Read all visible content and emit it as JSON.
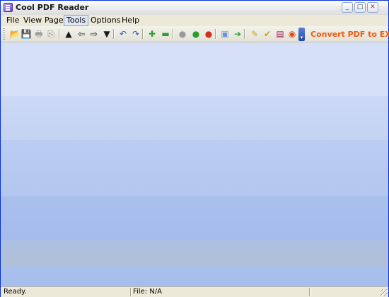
{
  "window": {
    "title": "Cool PDF Reader",
    "controls": {
      "minimize": "_",
      "maximize": "□",
      "close": "✕"
    }
  },
  "menu": {
    "items": [
      {
        "label": "File"
      },
      {
        "label": "View"
      },
      {
        "label": "Page"
      },
      {
        "label": "Tools",
        "active": true
      },
      {
        "label": "Options"
      },
      {
        "label": "Help"
      }
    ]
  },
  "toolbar": {
    "buttons": [
      {
        "name": "open-file-icon",
        "glyph": "📂",
        "color": "#e8a020"
      },
      {
        "name": "save-icon",
        "glyph": "💾",
        "color": "#4a6fc0"
      },
      {
        "name": "print-icon",
        "glyph": "🖶",
        "color": "#9a9a9a"
      },
      {
        "name": "copy-icon",
        "glyph": "⎘",
        "color": "#8a8a8a"
      },
      {
        "name": "first-page-icon",
        "glyph": "▲",
        "color": "#1a1a1a"
      },
      {
        "name": "previous-page-icon",
        "glyph": "⇦",
        "color": "#1a1a1a"
      },
      {
        "name": "next-page-icon",
        "glyph": "⇨",
        "color": "#1a1a1a"
      },
      {
        "name": "last-page-icon",
        "glyph": "▼",
        "color": "#1a1a1a"
      },
      {
        "name": "rotate-left-icon",
        "glyph": "↶",
        "color": "#2a5ad0"
      },
      {
        "name": "rotate-right-icon",
        "glyph": "↷",
        "color": "#2a5ad0"
      },
      {
        "name": "zoom-in-icon",
        "glyph": "✚",
        "color": "#2ea02e"
      },
      {
        "name": "zoom-out-icon",
        "glyph": "▬",
        "color": "#2ea02e"
      },
      {
        "name": "gray-light-icon",
        "glyph": "●",
        "color": "#9a9a9a"
      },
      {
        "name": "green-light-icon",
        "glyph": "●",
        "color": "#28a028"
      },
      {
        "name": "red-light-icon",
        "glyph": "●",
        "color": "#d03020"
      },
      {
        "name": "page-view-icon",
        "glyph": "▣",
        "color": "#6b8fd8"
      },
      {
        "name": "go-icon",
        "glyph": "➔",
        "color": "#2ea02e"
      },
      {
        "name": "settings-icon",
        "glyph": "✎",
        "color": "#d0a020"
      },
      {
        "name": "checkmark-icon",
        "glyph": "✔",
        "color": "#c8a020"
      },
      {
        "name": "book-icon",
        "glyph": "▤",
        "color": "#a02060"
      },
      {
        "name": "pdf-icon",
        "glyph": "◉",
        "color": "#e04a10"
      }
    ],
    "promo_label": "Convert PDF to EXE?",
    "promo_color": "#f05a10"
  },
  "statusbar": {
    "status": "Ready.",
    "file_label": "File: N/A"
  }
}
